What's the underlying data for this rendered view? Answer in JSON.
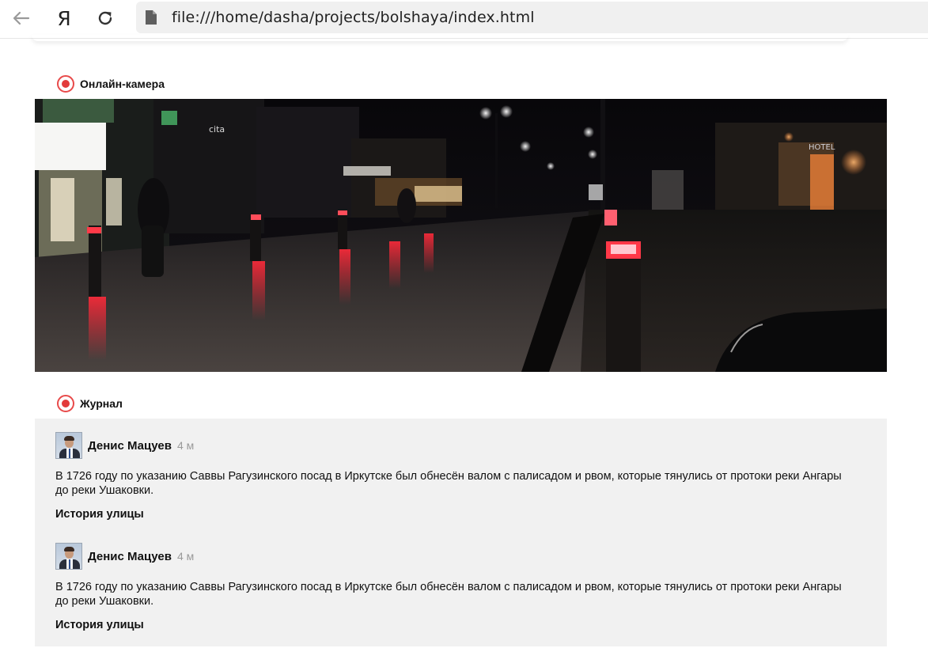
{
  "browser": {
    "back_icon": "back-arrow-icon",
    "yandex_logo": "Я",
    "reload_icon": "reload-icon",
    "file_icon": "file-icon",
    "url": "file:///home/dasha/projects/bolshaya/index.html"
  },
  "camera_section": {
    "title": "Онлайн-камера",
    "icon": "record-icon"
  },
  "journal_section": {
    "title": "Журнал",
    "icon": "record-icon",
    "entries": [
      {
        "author": "Денис Мацуев",
        "time": "4 м",
        "text": "В 1726 году по указанию Саввы Рагузинского посад в Иркутске был обнесён валом с палисадом и рвом, которые тянулись от протоки реки Ангары до реки Ушаковки.",
        "tag": "История улицы"
      },
      {
        "author": "Денис Мацуев",
        "time": "4 м",
        "text": "В 1726 году по указанию Саввы Рагузинского посад в Иркутске был обнесён валом с палисадом и рвом, которые тянулись от протоки реки Ангары до реки Ушаковки.",
        "tag": "История улицы"
      }
    ]
  },
  "colors": {
    "record_accent": "#e23b3b",
    "journal_background": "#f1f1f1",
    "timestamp": "#9a9a9a"
  }
}
